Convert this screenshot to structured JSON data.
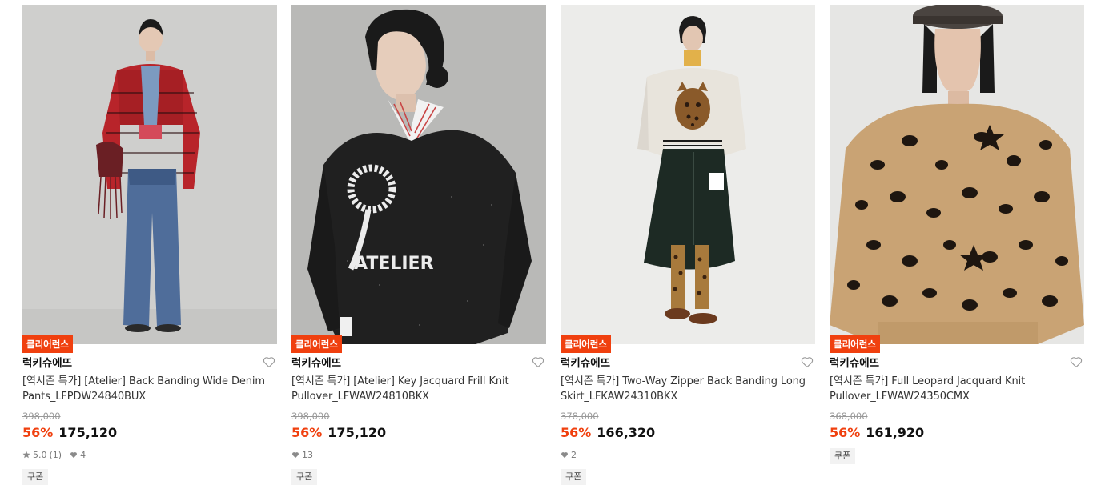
{
  "products": [
    {
      "badge": "클리어런스",
      "brand": "럭키슈에뜨",
      "name": "[역시즌 특가] [Atelier] Back Banding Wide Denim Pants_LFPDW24840BUX",
      "original_price": "398,000",
      "discount": "56%",
      "price": "175,120",
      "rating": "5.0",
      "review_count": "(1)",
      "likes": "4",
      "coupon": "쿠폰",
      "icons": [
        "heart-outline-icon",
        "star-icon",
        "heart-filled-icon"
      ]
    },
    {
      "badge": "클리어런스",
      "brand": "럭키슈에뜨",
      "name": "[역시즌 특가] [Atelier] Key Jacquard Frill Knit Pullover_LFWAW24810BKX",
      "original_price": "398,000",
      "discount": "56%",
      "price": "175,120",
      "likes": "13",
      "coupon": "쿠폰",
      "photo_text": "ATELIER",
      "icons": [
        "heart-outline-icon",
        "heart-filled-icon"
      ]
    },
    {
      "badge": "클리어런스",
      "brand": "럭키슈에뜨",
      "name": "[역시즌 특가] Two-Way Zipper Back Banding Long Skirt_LFKAW24310BKX",
      "original_price": "378,000",
      "discount": "56%",
      "price": "166,320",
      "likes": "2",
      "coupon": "쿠폰",
      "icons": [
        "heart-outline-icon",
        "heart-filled-icon"
      ]
    },
    {
      "badge": "클리어런스",
      "brand": "럭키슈에뜨",
      "name": "[역시즌 특가] Full Leopard Jacquard Knit Pullover_LFWAW24350CMX",
      "original_price": "368,000",
      "discount": "56%",
      "price": "161,920",
      "coupon": "쿠폰",
      "icons": [
        "heart-outline-icon"
      ]
    }
  ],
  "colors": {
    "accent": "#f0400f",
    "text": "#111111",
    "muted": "#999999",
    "coupon_bg": "#f2f2f2"
  }
}
